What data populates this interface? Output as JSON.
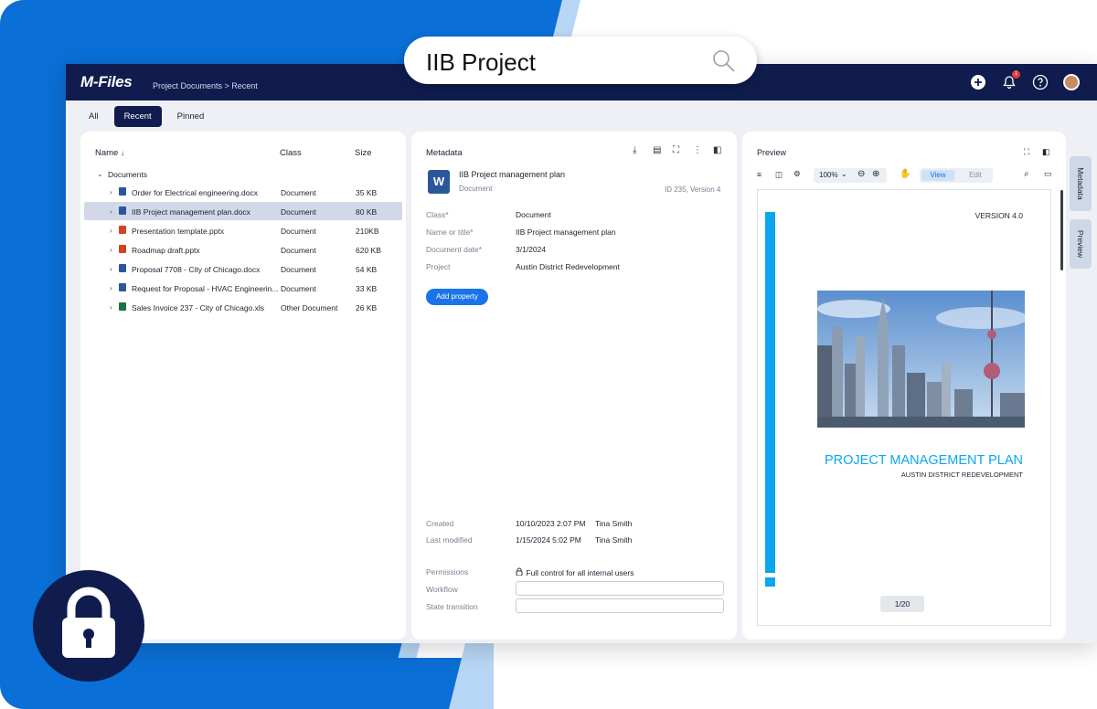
{
  "search": {
    "query": "IIB Project"
  },
  "app": {
    "logo": "M-Files",
    "breadcrumb": "Project Documents > Recent",
    "notifications_count": "1",
    "icons": [
      "add-icon",
      "bell-icon",
      "help-icon",
      "avatar"
    ]
  },
  "tabs": [
    {
      "label": "All",
      "active": false
    },
    {
      "label": "Recent",
      "active": true
    },
    {
      "label": "Pinned",
      "active": false
    }
  ],
  "list": {
    "columns": {
      "name": "Name",
      "class": "Class",
      "size": "Size"
    },
    "group": "Documents",
    "rows": [
      {
        "name": "Order for Electrical engineering.docx",
        "class": "Document",
        "size": "35 KB",
        "type": "word",
        "selected": false
      },
      {
        "name": "IIB Project management plan.docx",
        "class": "Document",
        "size": "80 KB",
        "type": "word",
        "selected": true
      },
      {
        "name": "Presentation template.pptx",
        "class": "Document",
        "size": "210KB",
        "type": "powerpoint",
        "selected": false
      },
      {
        "name": "Roadmap draft.pptx",
        "class": "Document",
        "size": "620 KB",
        "type": "powerpoint",
        "selected": false
      },
      {
        "name": "Proposal 7708 - City of Chicago.docx",
        "class": "Document",
        "size": "54 KB",
        "type": "word",
        "selected": false
      },
      {
        "name": "Request for Proposal - HVAC Engineerin...",
        "class": "Document",
        "size": "33 KB",
        "type": "word",
        "selected": false
      },
      {
        "name": "Sales Invoice 237 - City of Chicago.xls",
        "class": "Other Document",
        "size": "26 KB",
        "type": "excel",
        "selected": false
      }
    ]
  },
  "metadata": {
    "header": "Metadata",
    "doc_title": "IIB Project management plan",
    "doc_class": "Document",
    "doc_id": "ID 235, Version 4",
    "word_letter": "W",
    "props": [
      {
        "label": "Class*",
        "value": "Document"
      },
      {
        "label": "Name or title*",
        "value": "IIB Project management plan"
      },
      {
        "label": "Document date*",
        "value": "3/1/2024"
      },
      {
        "label": "Project",
        "value": "Austin District Redevelopment"
      }
    ],
    "add_property": "Add property",
    "created": {
      "label": "Created",
      "date": "10/10/2023 2:07 PM",
      "user": "Tina Smith"
    },
    "modified": {
      "label": "Last modified",
      "date": "1/15/2024 5:02 PM",
      "user": "Tina Smith"
    },
    "permissions": {
      "label": "Permissions",
      "value": "Full control for all internal users"
    },
    "workflow": {
      "label": "Workflow"
    },
    "state_transition": {
      "label": "State transition"
    }
  },
  "preview": {
    "header": "Preview",
    "zoom": "100%",
    "view_label": "View",
    "edit_label": "Edit",
    "doc_version": "VERSION 4.0",
    "doc_heading": "PROJECT MANAGEMENT PLAN",
    "doc_subheading": "AUSTIN DISTRICT REDEVELOPMENT",
    "page_indicator": "1/20"
  },
  "side_tabs": {
    "metadata": "Metadata",
    "preview": "Preview"
  },
  "colors": {
    "navy": "#0f1c4d",
    "brand_blue": "#0a6fd6",
    "accent": "#1a73e8",
    "cyan": "#0aa6f0"
  }
}
